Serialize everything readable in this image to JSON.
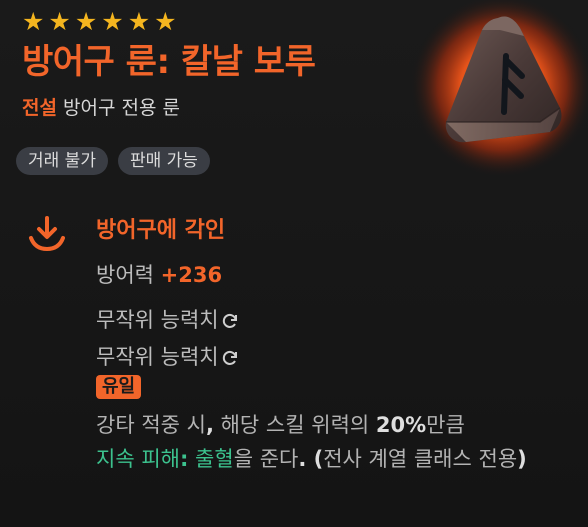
{
  "item": {
    "stars": [
      "★",
      "★",
      "★",
      "★",
      "★",
      "★"
    ],
    "title": "방어구 룬: 칼날 보루",
    "grade": "전설",
    "type": "방어구 전용 룬",
    "tags": [
      "거래 불가",
      "판매 가능"
    ],
    "icon": "armor-rune-icon"
  },
  "engrave": {
    "title": "방어구에 각인",
    "icon": "engrave-download-icon",
    "defense_label": "방어력",
    "defense_value": "+236",
    "random_stat_1": "무작위 능력치",
    "random_stat_2": "무작위 능력치",
    "reroll_icon": "reroll-icon",
    "unique_badge": "유일",
    "desc": {
      "p1": "강타 적중 시",
      "comma": ",",
      "p2": " 해당 스킬 위력의 ",
      "pct": "20%",
      "p3": "만큼",
      "green1": "지속 피해",
      "colon": ":",
      "green2": " 출혈",
      "p4": "을 준다",
      "p5": ". (",
      "p6": "전사 계열 클래스 전용",
      "p7": ")"
    }
  },
  "colors": {
    "accent": "#f2652a",
    "star": "#f4b51f",
    "green": "#3cc28e",
    "tag_bg": "#3a3d44",
    "background": "#161616"
  }
}
